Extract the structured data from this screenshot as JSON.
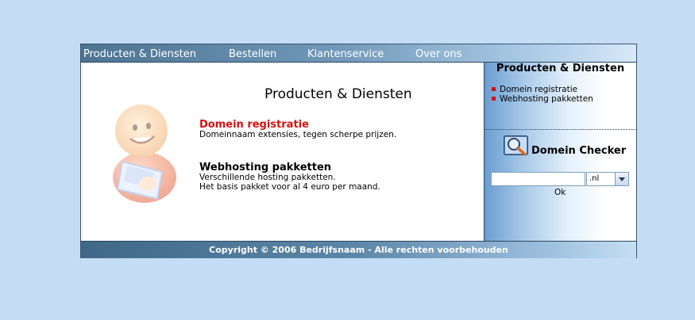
{
  "nav": {
    "items": [
      {
        "label": "Producten & Diensten"
      },
      {
        "label": "Bestellen"
      },
      {
        "label": "Klantenservice"
      },
      {
        "label": "Over ons"
      }
    ]
  },
  "main": {
    "title": "Producten & Diensten",
    "mascot_icon": "mascot-with-laptop-icon",
    "items": [
      {
        "title": "Domein registratie",
        "title_color": "#d31212",
        "description": [
          "Domeinnaam extensies, tegen scherpe prijzen."
        ]
      },
      {
        "title": "Webhosting pakketten",
        "title_color": "#000000",
        "description": [
          "Verschillende hosting pakketten.",
          "Het basis pakket voor al 4 euro per maand."
        ]
      }
    ]
  },
  "sidebar": {
    "title": "Producten & Diensten",
    "links": [
      {
        "label": "Domein registratie"
      },
      {
        "label": "Webhosting pakketten"
      }
    ],
    "checker": {
      "icon": "magnifier-icon",
      "title": "Domein Checker",
      "input_value": "",
      "tld_selected": ".nl",
      "ok_label": "Ok"
    }
  },
  "footer": {
    "copyright": "Copyright © 2006 Bedrijfsnaam - Alle rechten voorbehouden"
  },
  "colors": {
    "page_background": "#c5dcf5",
    "accent_red": "#d31212",
    "bar_dark": "#3f6786"
  }
}
